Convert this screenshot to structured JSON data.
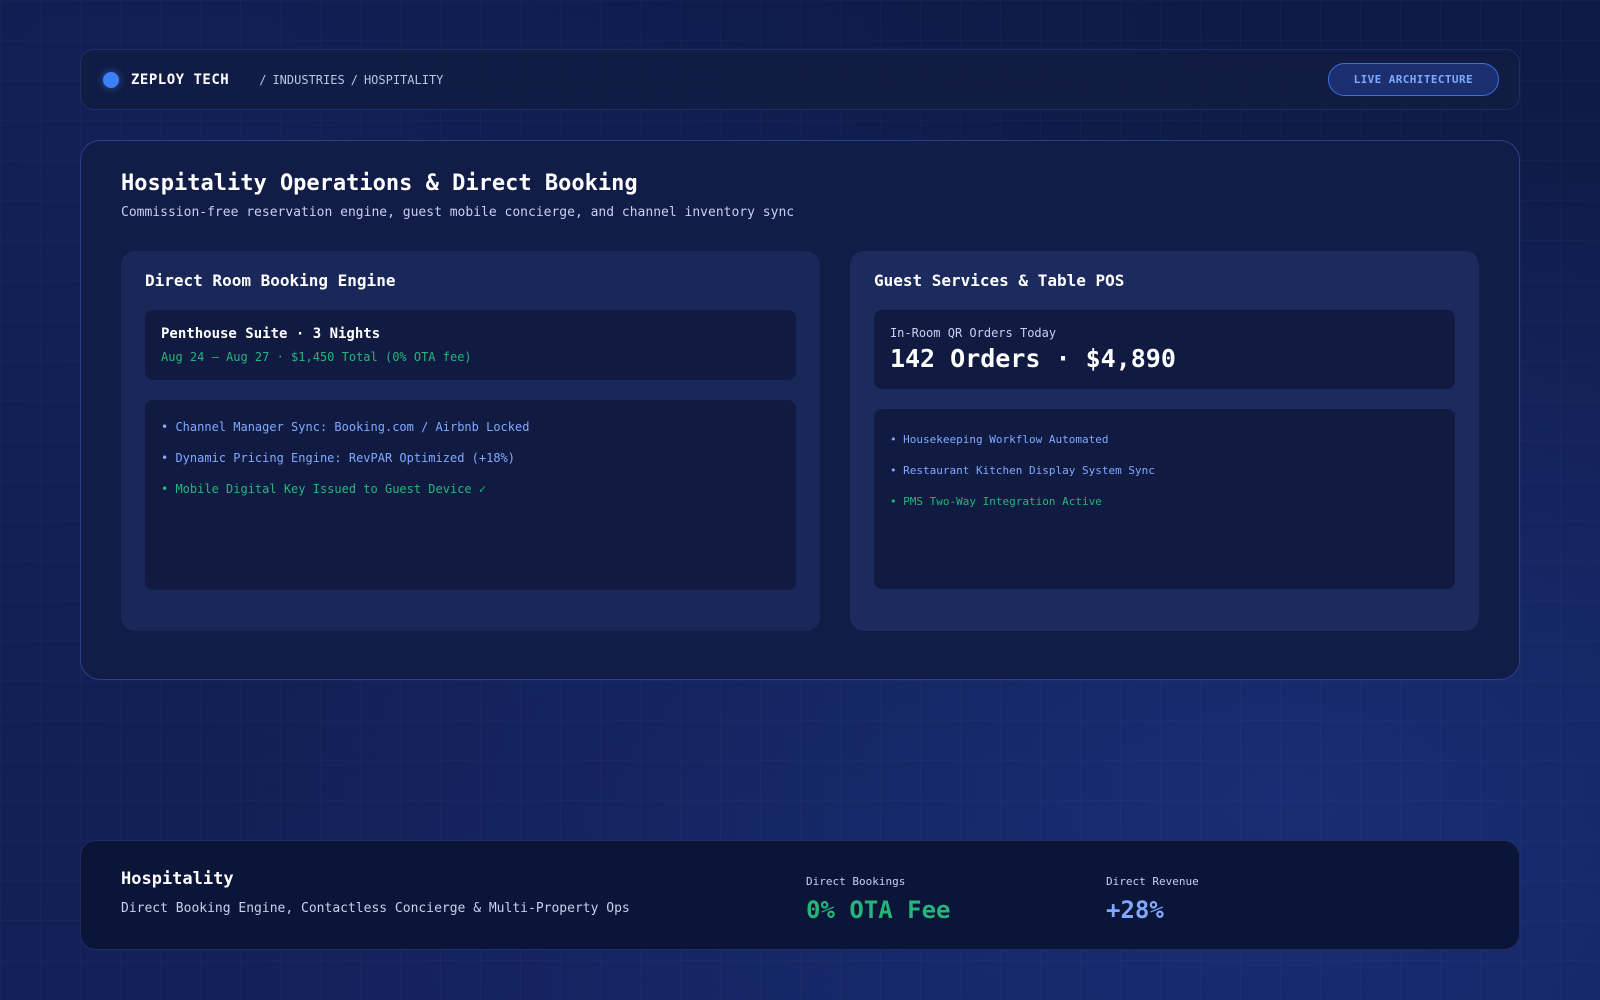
{
  "header": {
    "brand": "ZEPLOY TECH",
    "breadcrumb": [
      "INDUSTRIES",
      "HOSPITALITY"
    ],
    "cta_label": "LIVE ARCHITECTURE"
  },
  "main": {
    "title": "Hospitality Operations & Direct Booking",
    "subtitle": "Commission-free reservation engine, guest mobile concierge, and channel inventory sync",
    "booking_panel": {
      "title": "Direct Room Booking Engine",
      "reservation_title": "Penthouse Suite · 3 Nights",
      "reservation_detail": "Aug 24 – Aug 27 · $1,450 Total (0% OTA fee)",
      "items": [
        "• Channel Manager Sync: Booking.com / Airbnb Locked",
        "• Dynamic Pricing Engine: RevPAR Optimized (+18%)",
        "• Mobile Digital Key Issued to Guest Device ✓"
      ]
    },
    "services_panel": {
      "title": "Guest Services & Table POS",
      "stat_label": "In-Room QR Orders Today",
      "stat_value": "142 Orders · $4,890",
      "items": [
        "• Housekeeping Workflow Automated",
        "• Restaurant Kitchen Display System Sync",
        "• PMS Two-Way Integration Active"
      ]
    }
  },
  "footer": {
    "title": "Hospitality",
    "subtitle": "Direct Booking Engine, Contactless Concierge & Multi-Property Ops",
    "metrics": [
      {
        "label": "Direct Bookings",
        "value": "0% OTA Fee"
      },
      {
        "label": "Direct Revenue",
        "value": "+28%"
      }
    ]
  },
  "colors": {
    "accent_blue": "#3b82f6",
    "link_blue": "#7fa9ff",
    "success_green": "#25b57a",
    "background": "#0f1a44"
  }
}
